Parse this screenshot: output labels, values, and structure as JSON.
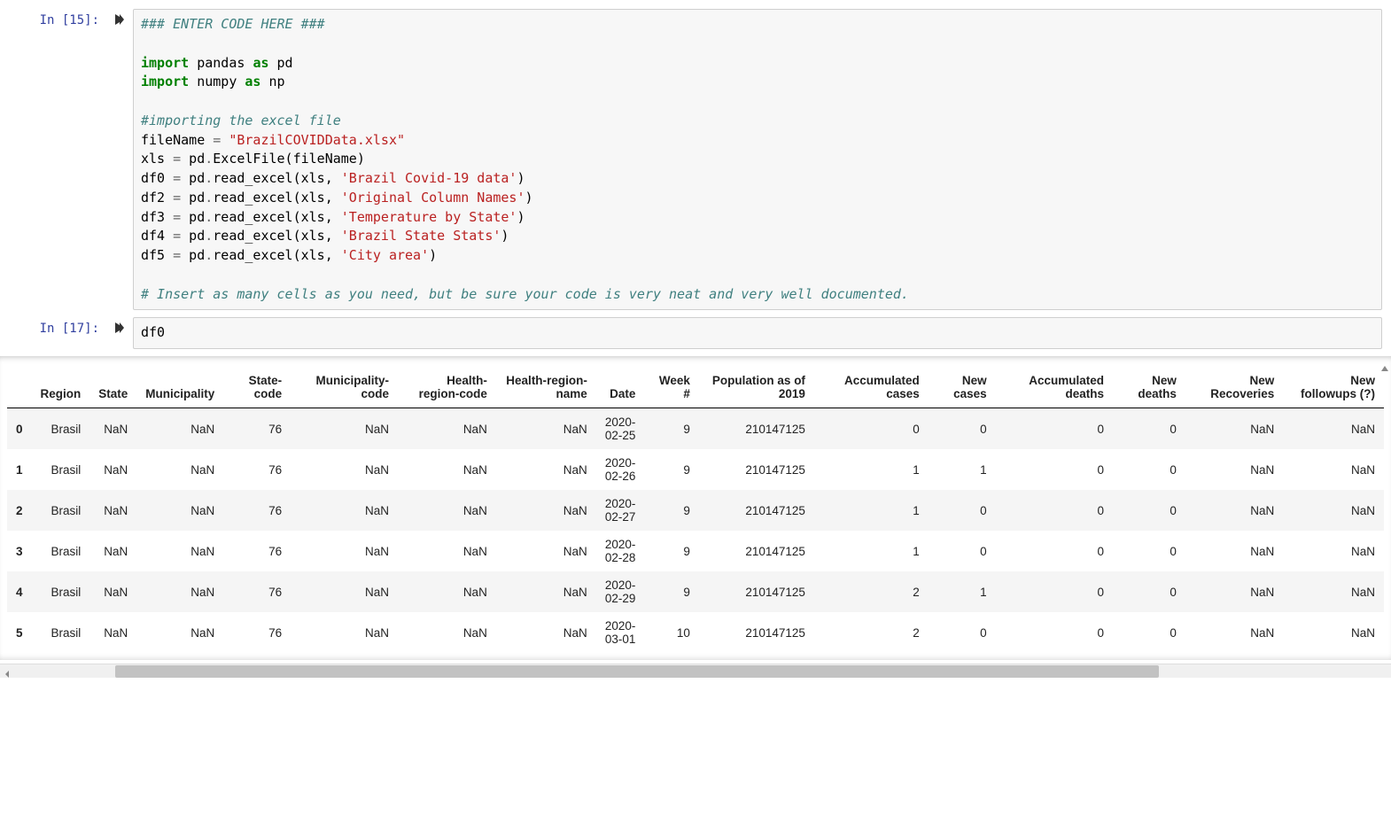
{
  "cells": {
    "cell0": {
      "prompt": "In [15]:",
      "code_tokens": [
        {
          "t": "### ENTER CODE HERE ###",
          "c": "cm"
        },
        {
          "t": "\n\n"
        },
        {
          "t": "import",
          "c": "kw"
        },
        {
          "t": " pandas "
        },
        {
          "t": "as",
          "c": "kw"
        },
        {
          "t": " pd\n"
        },
        {
          "t": "import",
          "c": "kw"
        },
        {
          "t": " numpy "
        },
        {
          "t": "as",
          "c": "kw"
        },
        {
          "t": " np\n\n"
        },
        {
          "t": "#importing the excel file",
          "c": "cm"
        },
        {
          "t": "\n"
        },
        {
          "t": "fileName "
        },
        {
          "t": "=",
          "c": "op"
        },
        {
          "t": " "
        },
        {
          "t": "\"BrazilCOVIDData.xlsx\"",
          "c": "str"
        },
        {
          "t": "\n"
        },
        {
          "t": "xls "
        },
        {
          "t": "=",
          "c": "op"
        },
        {
          "t": " pd"
        },
        {
          "t": ".",
          "c": "op"
        },
        {
          "t": "ExcelFile(fileName)\n"
        },
        {
          "t": "df0 "
        },
        {
          "t": "=",
          "c": "op"
        },
        {
          "t": " pd"
        },
        {
          "t": ".",
          "c": "op"
        },
        {
          "t": "read_excel(xls, "
        },
        {
          "t": "'Brazil Covid-19 data'",
          "c": "str"
        },
        {
          "t": ")\n"
        },
        {
          "t": "df2 "
        },
        {
          "t": "=",
          "c": "op"
        },
        {
          "t": " pd"
        },
        {
          "t": ".",
          "c": "op"
        },
        {
          "t": "read_excel(xls, "
        },
        {
          "t": "'Original Column Names'",
          "c": "str"
        },
        {
          "t": ")\n"
        },
        {
          "t": "df3 "
        },
        {
          "t": "=",
          "c": "op"
        },
        {
          "t": " pd"
        },
        {
          "t": ".",
          "c": "op"
        },
        {
          "t": "read_excel(xls, "
        },
        {
          "t": "'Temperature by State'",
          "c": "str"
        },
        {
          "t": ")\n"
        },
        {
          "t": "df4 "
        },
        {
          "t": "=",
          "c": "op"
        },
        {
          "t": " pd"
        },
        {
          "t": ".",
          "c": "op"
        },
        {
          "t": "read_excel(xls, "
        },
        {
          "t": "'Brazil State Stats'",
          "c": "str"
        },
        {
          "t": ")\n"
        },
        {
          "t": "df5 "
        },
        {
          "t": "=",
          "c": "op"
        },
        {
          "t": " pd"
        },
        {
          "t": ".",
          "c": "op"
        },
        {
          "t": "read_excel(xls, "
        },
        {
          "t": "'City area'",
          "c": "str"
        },
        {
          "t": ")\n\n"
        },
        {
          "t": "# Insert as many cells as you need, but be sure your code is very neat and very well documented.",
          "c": "cm"
        }
      ]
    },
    "cell1": {
      "prompt": "In [17]:",
      "code_tokens": [
        {
          "t": "df0"
        }
      ]
    }
  },
  "dataframe": {
    "columns": [
      "",
      "Region",
      "State",
      "Municipality",
      "State-code",
      "Municipality-code",
      "Health-region-code",
      "Health-region-name",
      "Date",
      "Week #",
      "Population as of 2019",
      "Accumulated cases",
      "New cases",
      "Accumulated deaths",
      "New deaths",
      "New Recoveries",
      "New followups (?)"
    ],
    "rows": [
      [
        "0",
        "Brasil",
        "NaN",
        "NaN",
        "76",
        "NaN",
        "NaN",
        "NaN",
        "2020-02-25",
        "9",
        "210147125",
        "0",
        "0",
        "0",
        "0",
        "NaN",
        "NaN"
      ],
      [
        "1",
        "Brasil",
        "NaN",
        "NaN",
        "76",
        "NaN",
        "NaN",
        "NaN",
        "2020-02-26",
        "9",
        "210147125",
        "1",
        "1",
        "0",
        "0",
        "NaN",
        "NaN"
      ],
      [
        "2",
        "Brasil",
        "NaN",
        "NaN",
        "76",
        "NaN",
        "NaN",
        "NaN",
        "2020-02-27",
        "9",
        "210147125",
        "1",
        "0",
        "0",
        "0",
        "NaN",
        "NaN"
      ],
      [
        "3",
        "Brasil",
        "NaN",
        "NaN",
        "76",
        "NaN",
        "NaN",
        "NaN",
        "2020-02-28",
        "9",
        "210147125",
        "1",
        "0",
        "0",
        "0",
        "NaN",
        "NaN"
      ],
      [
        "4",
        "Brasil",
        "NaN",
        "NaN",
        "76",
        "NaN",
        "NaN",
        "NaN",
        "2020-02-29",
        "9",
        "210147125",
        "2",
        "1",
        "0",
        "0",
        "NaN",
        "NaN"
      ],
      [
        "5",
        "Brasil",
        "NaN",
        "NaN",
        "76",
        "NaN",
        "NaN",
        "NaN",
        "2020-03-01",
        "10",
        "210147125",
        "2",
        "0",
        "0",
        "0",
        "NaN",
        "NaN"
      ]
    ]
  }
}
